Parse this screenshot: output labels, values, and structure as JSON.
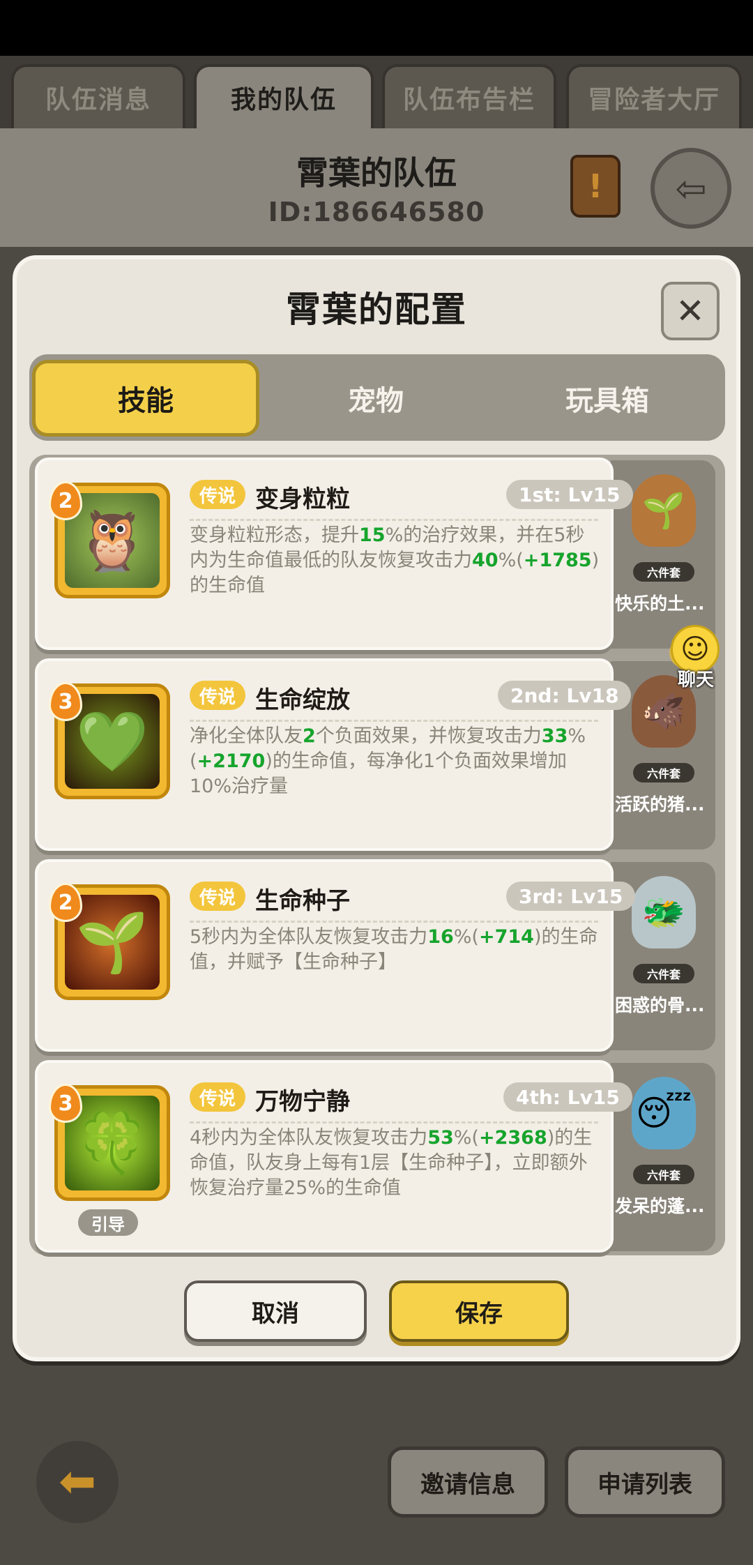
{
  "top_tabs": [
    {
      "label": "队伍消息"
    },
    {
      "label": "我的队伍"
    },
    {
      "label": "队伍布告栏"
    },
    {
      "label": "冒险者大厅"
    }
  ],
  "team": {
    "name": "霄葉的队伍",
    "id": "ID:186646580"
  },
  "modal": {
    "title": "霄葉的配置",
    "close_symbol": "✕",
    "segments": [
      {
        "label": "技能"
      },
      {
        "label": "宠物"
      },
      {
        "label": "玩具箱"
      }
    ]
  },
  "skills": [
    {
      "level": "2",
      "rarity": "传说",
      "name": "变身粒粒",
      "slot": "1st: Lv15",
      "desc": [
        {
          "t": "变身粒粒形态，提升"
        },
        {
          "t": "15",
          "hl": true
        },
        {
          "t": "%的治疗效果，并在5秒内为生命值最低的队友恢复攻击力"
        },
        {
          "t": "40",
          "hl": true
        },
        {
          "t": "%("
        },
        {
          "t": "+1785",
          "hl": true
        },
        {
          "t": ")的生命值"
        }
      ],
      "icon": "owl-icon",
      "pet": {
        "name": "快乐的土...",
        "tag": "六件套",
        "icon": "mandrake-pet-icon"
      }
    },
    {
      "level": "3",
      "rarity": "传说",
      "name": "生命绽放",
      "slot": "2nd: Lv18",
      "desc": [
        {
          "t": "净化全体队友"
        },
        {
          "t": "2",
          "hl": true
        },
        {
          "t": "个负面效果，并恢复攻击力"
        },
        {
          "t": "33",
          "hl": true
        },
        {
          "t": "%("
        },
        {
          "t": "+2170",
          "hl": true
        },
        {
          "t": ")的生命值，每净化1个负面效果增加10%治疗量"
        }
      ],
      "icon": "heart-flower-icon",
      "pet": {
        "name": "活跃的猪...",
        "tag": "六件套",
        "icon": "boar-pet-icon"
      }
    },
    {
      "level": "2",
      "rarity": "传说",
      "name": "生命种子",
      "slot": "3rd: Lv15",
      "desc": [
        {
          "t": "5秒内为全体队友恢复攻击力"
        },
        {
          "t": "16",
          "hl": true
        },
        {
          "t": "%("
        },
        {
          "t": "+714",
          "hl": true
        },
        {
          "t": ")的生命值，并赋予【生命种子】"
        }
      ],
      "icon": "seed-icon",
      "pet": {
        "name": "困惑的骨...",
        "tag": "六件套",
        "icon": "bone-dragon-pet-icon"
      }
    },
    {
      "level": "3",
      "rarity": "传说",
      "name": "万物宁静",
      "slot": "4th: Lv15",
      "desc": [
        {
          "t": "4秒内为全体队友恢复攻击力"
        },
        {
          "t": "53",
          "hl": true
        },
        {
          "t": "%("
        },
        {
          "t": "+2368",
          "hl": true
        },
        {
          "t": ")的生命值，队友身上每有1层【生命种子】，立即额外恢复治疗量25%的生命值"
        }
      ],
      "icon": "clover-field-icon",
      "tag": "引导",
      "pet": {
        "name": "发呆的蓬...",
        "tag": "六件套",
        "icon": "sleepy-pet-icon"
      }
    }
  ],
  "chat": {
    "label": "聊天"
  },
  "buttons": {
    "cancel": "取消",
    "save": "保存"
  },
  "bottom": {
    "invite": "邀请信息",
    "apply_list": "申请列表"
  },
  "colors": {
    "accent_yellow": "#f4d04a",
    "highlight_green": "#16a42c",
    "rarity_gold": "#f3c53c"
  }
}
